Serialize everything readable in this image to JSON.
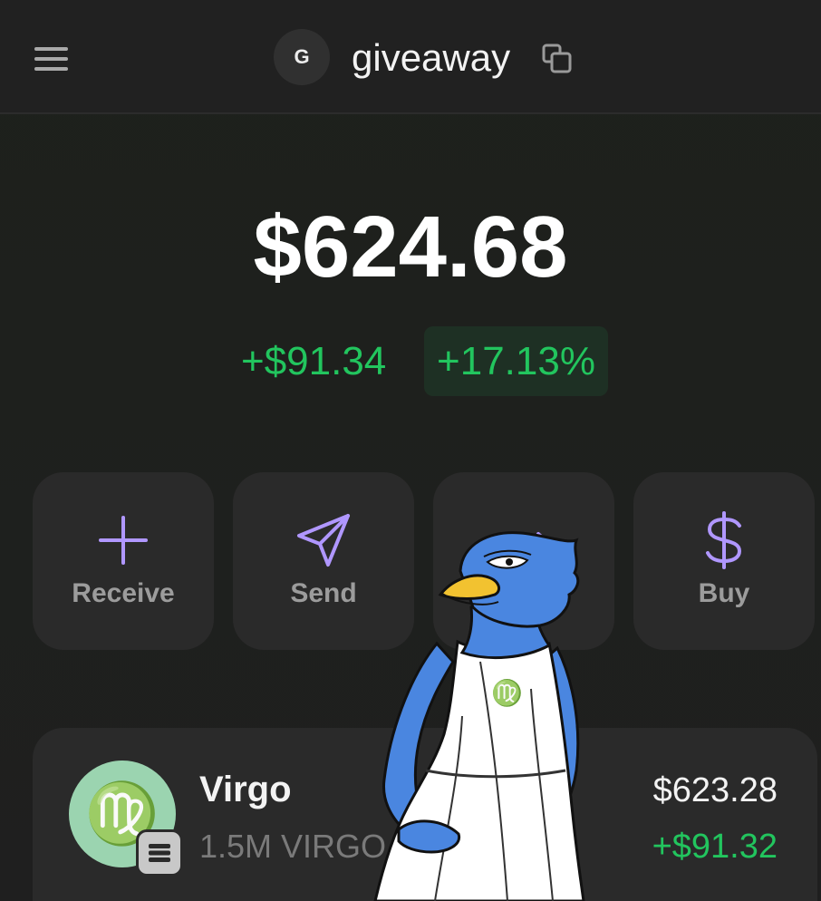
{
  "header": {
    "menu_icon": "hamburger-menu-icon",
    "avatar_letter": "G",
    "account_name": "giveaway",
    "copy_icon": "copy-icon"
  },
  "balance": {
    "total": "$624.68",
    "change_amount": "+$91.34",
    "change_percent": "+17.13%"
  },
  "actions": [
    {
      "label": "Receive",
      "icon": "plus-icon"
    },
    {
      "label": "Send",
      "icon": "send-icon"
    },
    {
      "label": "",
      "icon": "swap-arrow-icon"
    },
    {
      "label": "Buy",
      "icon": "dollar-icon"
    }
  ],
  "tokens": [
    {
      "name": "Virgo",
      "amount": "1.5M VIRGO",
      "value": "$623.28",
      "change": "+$91.32",
      "avatar_glyph": "♍",
      "chain_icon": "solana-icon"
    }
  ],
  "colors": {
    "accent": "#b097ff",
    "positive": "#22c55e",
    "background": "#1f1f1f",
    "card": "#2a2a2a",
    "token_avatar": "#9bd4b0",
    "mascot_blue": "#4a86e0"
  }
}
